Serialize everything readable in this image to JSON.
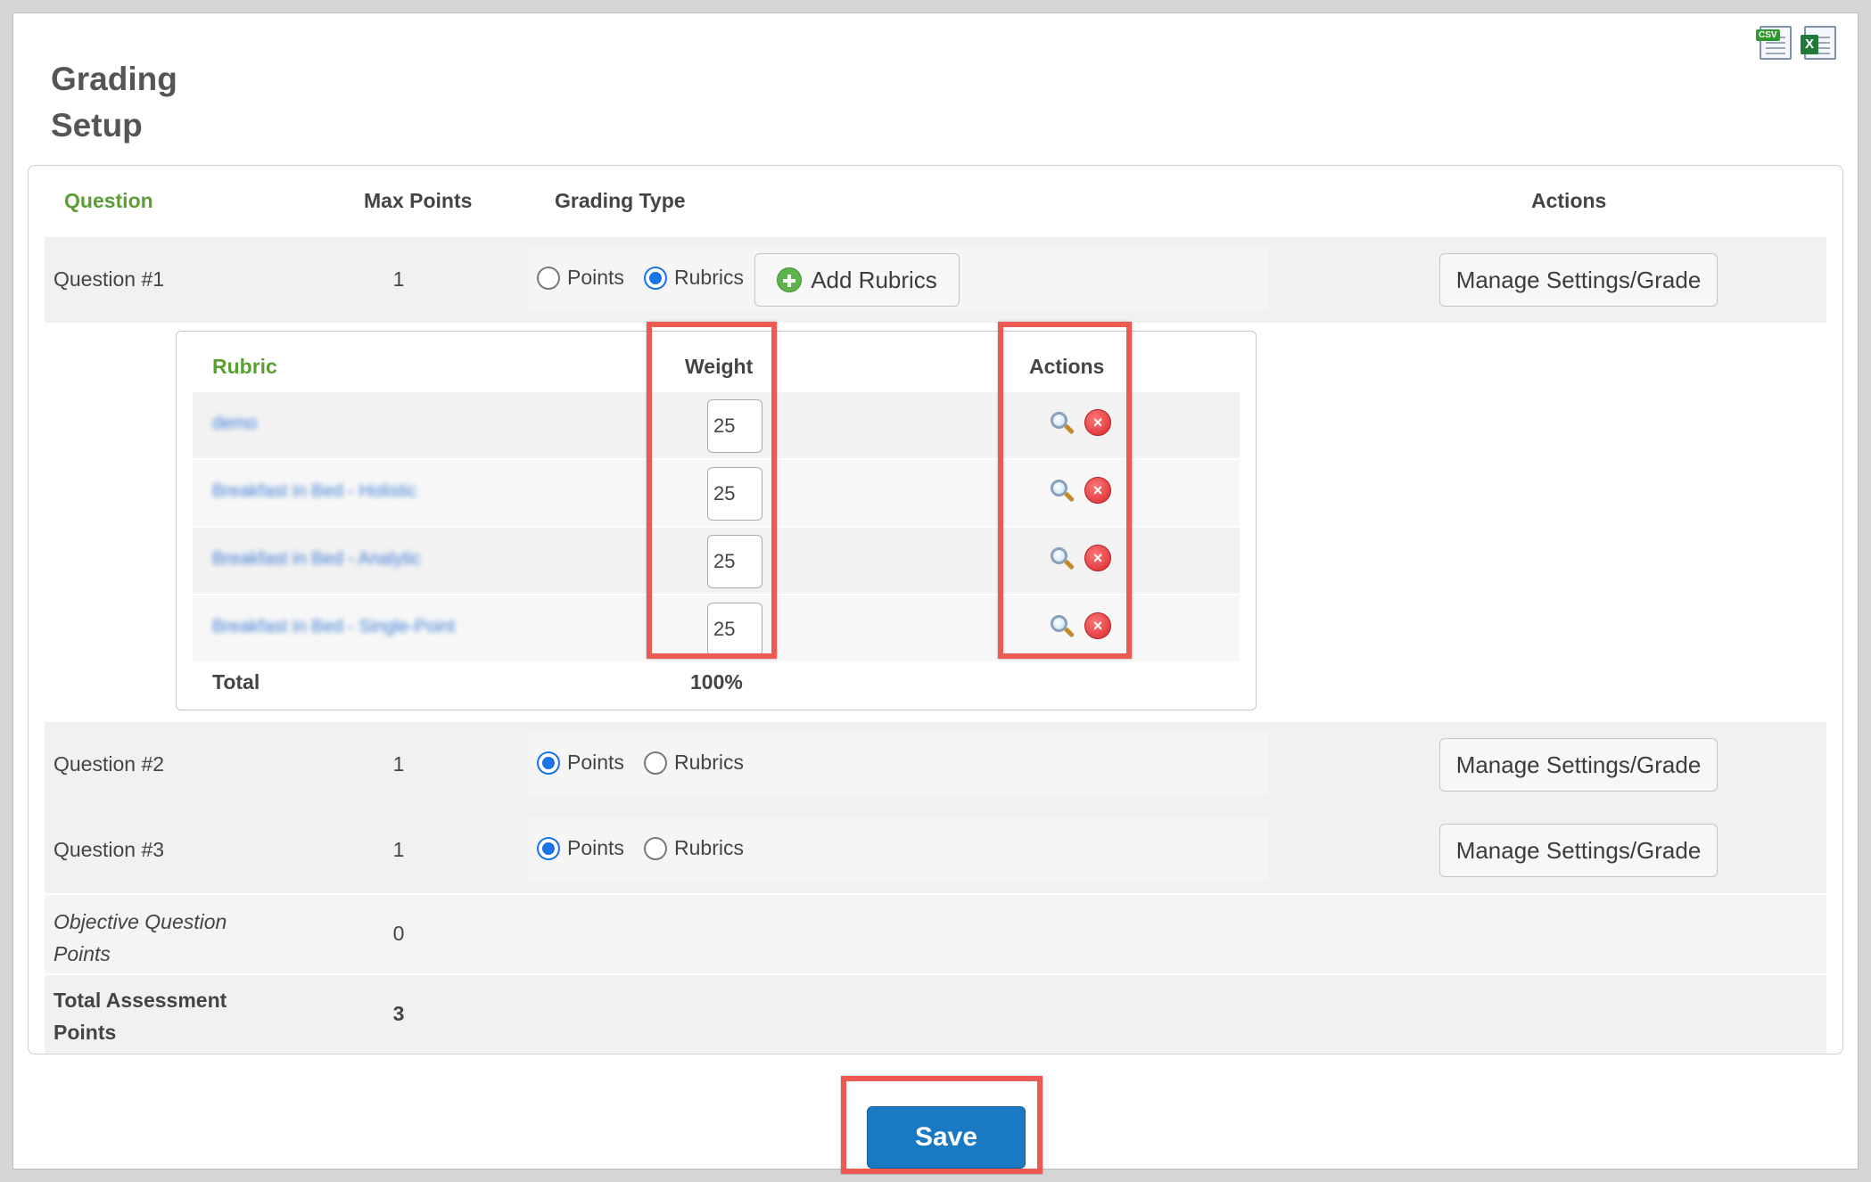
{
  "page": {
    "title": "Grading Setup"
  },
  "toolbar": {
    "csv_tag": "CSV",
    "xls_tag": "X"
  },
  "table": {
    "headers": {
      "question": "Question",
      "max_points": "Max Points",
      "grading_type": "Grading Type",
      "actions": "Actions"
    },
    "questions": [
      {
        "name": "Question #1",
        "max": "1",
        "points_label": "Points",
        "rubrics_label": "Rubrics",
        "selected": "rubrics",
        "add_rubrics": "Add Rubrics",
        "manage": "Manage Settings/Grade"
      },
      {
        "name": "Question #2",
        "max": "1",
        "points_label": "Points",
        "rubrics_label": "Rubrics",
        "selected": "points",
        "manage": "Manage Settings/Grade"
      },
      {
        "name": "Question #3",
        "max": "1",
        "points_label": "Points",
        "rubrics_label": "Rubrics",
        "selected": "points",
        "manage": "Manage Settings/Grade"
      }
    ],
    "objective": {
      "label_line1": "Objective Question",
      "label_line2": "Points",
      "value": "0"
    },
    "total": {
      "label_line1": "Total Assessment",
      "label_line2": "Points",
      "value": "3"
    }
  },
  "rubrics": {
    "headers": {
      "rubric": "Rubric",
      "weight": "Weight",
      "actions": "Actions"
    },
    "items": [
      {
        "name": "demo",
        "weight": "25"
      },
      {
        "name": "Breakfast in Bed - Holistic",
        "weight": "25"
      },
      {
        "name": "Breakfast in Bed - Analytic",
        "weight": "25"
      },
      {
        "name": "Breakfast in Bed - Single-Point",
        "weight": "25"
      }
    ],
    "total_label": "Total",
    "total_value": "100%",
    "delete_glyph": "×"
  },
  "save_label": "Save",
  "colors": {
    "accent_green": "#5a9e34",
    "primary_blue": "#1979c3",
    "highlight_red": "#ec5a52",
    "radio_blue": "#1a73e8",
    "link_blue": "#3f7fd6"
  },
  "icons": [
    "csv-export-icon",
    "excel-export-icon",
    "add-circle-icon",
    "magnifier-icon",
    "delete-icon"
  ]
}
